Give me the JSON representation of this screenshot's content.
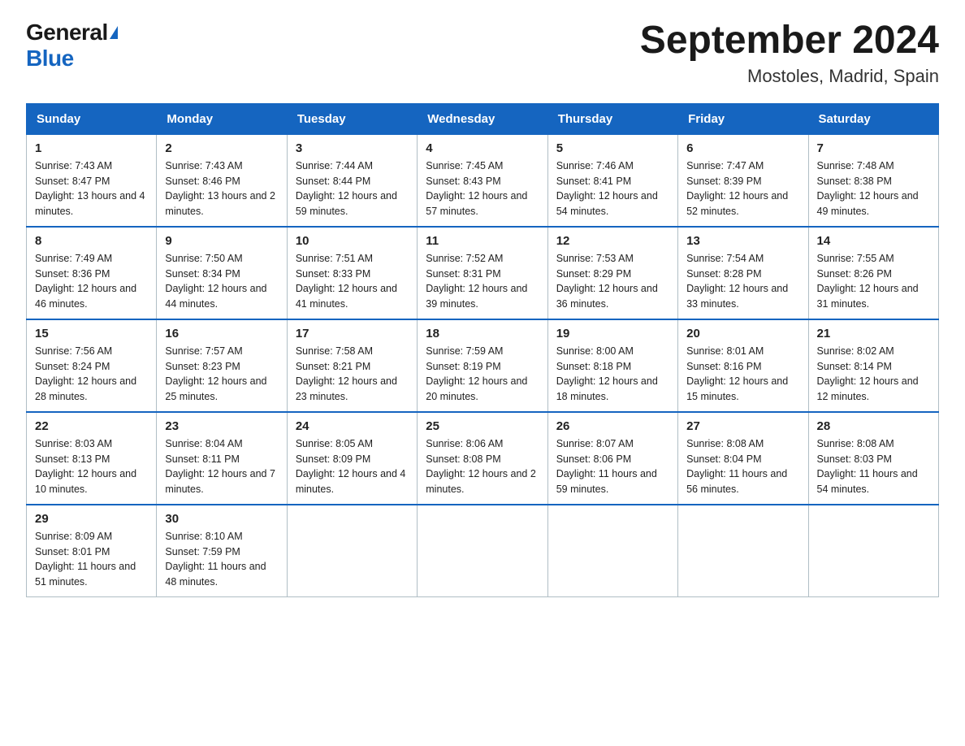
{
  "logo": {
    "text_general": "General",
    "text_blue": "Blue"
  },
  "title": "September 2024",
  "subtitle": "Mostoles, Madrid, Spain",
  "days_of_week": [
    "Sunday",
    "Monday",
    "Tuesday",
    "Wednesday",
    "Thursday",
    "Friday",
    "Saturday"
  ],
  "weeks": [
    [
      {
        "day": "1",
        "sunrise": "7:43 AM",
        "sunset": "8:47 PM",
        "daylight": "13 hours and 4 minutes."
      },
      {
        "day": "2",
        "sunrise": "7:43 AM",
        "sunset": "8:46 PM",
        "daylight": "13 hours and 2 minutes."
      },
      {
        "day": "3",
        "sunrise": "7:44 AM",
        "sunset": "8:44 PM",
        "daylight": "12 hours and 59 minutes."
      },
      {
        "day": "4",
        "sunrise": "7:45 AM",
        "sunset": "8:43 PM",
        "daylight": "12 hours and 57 minutes."
      },
      {
        "day": "5",
        "sunrise": "7:46 AM",
        "sunset": "8:41 PM",
        "daylight": "12 hours and 54 minutes."
      },
      {
        "day": "6",
        "sunrise": "7:47 AM",
        "sunset": "8:39 PM",
        "daylight": "12 hours and 52 minutes."
      },
      {
        "day": "7",
        "sunrise": "7:48 AM",
        "sunset": "8:38 PM",
        "daylight": "12 hours and 49 minutes."
      }
    ],
    [
      {
        "day": "8",
        "sunrise": "7:49 AM",
        "sunset": "8:36 PM",
        "daylight": "12 hours and 46 minutes."
      },
      {
        "day": "9",
        "sunrise": "7:50 AM",
        "sunset": "8:34 PM",
        "daylight": "12 hours and 44 minutes."
      },
      {
        "day": "10",
        "sunrise": "7:51 AM",
        "sunset": "8:33 PM",
        "daylight": "12 hours and 41 minutes."
      },
      {
        "day": "11",
        "sunrise": "7:52 AM",
        "sunset": "8:31 PM",
        "daylight": "12 hours and 39 minutes."
      },
      {
        "day": "12",
        "sunrise": "7:53 AM",
        "sunset": "8:29 PM",
        "daylight": "12 hours and 36 minutes."
      },
      {
        "day": "13",
        "sunrise": "7:54 AM",
        "sunset": "8:28 PM",
        "daylight": "12 hours and 33 minutes."
      },
      {
        "day": "14",
        "sunrise": "7:55 AM",
        "sunset": "8:26 PM",
        "daylight": "12 hours and 31 minutes."
      }
    ],
    [
      {
        "day": "15",
        "sunrise": "7:56 AM",
        "sunset": "8:24 PM",
        "daylight": "12 hours and 28 minutes."
      },
      {
        "day": "16",
        "sunrise": "7:57 AM",
        "sunset": "8:23 PM",
        "daylight": "12 hours and 25 minutes."
      },
      {
        "day": "17",
        "sunrise": "7:58 AM",
        "sunset": "8:21 PM",
        "daylight": "12 hours and 23 minutes."
      },
      {
        "day": "18",
        "sunrise": "7:59 AM",
        "sunset": "8:19 PM",
        "daylight": "12 hours and 20 minutes."
      },
      {
        "day": "19",
        "sunrise": "8:00 AM",
        "sunset": "8:18 PM",
        "daylight": "12 hours and 18 minutes."
      },
      {
        "day": "20",
        "sunrise": "8:01 AM",
        "sunset": "8:16 PM",
        "daylight": "12 hours and 15 minutes."
      },
      {
        "day": "21",
        "sunrise": "8:02 AM",
        "sunset": "8:14 PM",
        "daylight": "12 hours and 12 minutes."
      }
    ],
    [
      {
        "day": "22",
        "sunrise": "8:03 AM",
        "sunset": "8:13 PM",
        "daylight": "12 hours and 10 minutes."
      },
      {
        "day": "23",
        "sunrise": "8:04 AM",
        "sunset": "8:11 PM",
        "daylight": "12 hours and 7 minutes."
      },
      {
        "day": "24",
        "sunrise": "8:05 AM",
        "sunset": "8:09 PM",
        "daylight": "12 hours and 4 minutes."
      },
      {
        "day": "25",
        "sunrise": "8:06 AM",
        "sunset": "8:08 PM",
        "daylight": "12 hours and 2 minutes."
      },
      {
        "day": "26",
        "sunrise": "8:07 AM",
        "sunset": "8:06 PM",
        "daylight": "11 hours and 59 minutes."
      },
      {
        "day": "27",
        "sunrise": "8:08 AM",
        "sunset": "8:04 PM",
        "daylight": "11 hours and 56 minutes."
      },
      {
        "day": "28",
        "sunrise": "8:08 AM",
        "sunset": "8:03 PM",
        "daylight": "11 hours and 54 minutes."
      }
    ],
    [
      {
        "day": "29",
        "sunrise": "8:09 AM",
        "sunset": "8:01 PM",
        "daylight": "11 hours and 51 minutes."
      },
      {
        "day": "30",
        "sunrise": "8:10 AM",
        "sunset": "7:59 PM",
        "daylight": "11 hours and 48 minutes."
      },
      null,
      null,
      null,
      null,
      null
    ]
  ],
  "labels": {
    "sunrise": "Sunrise:",
    "sunset": "Sunset:",
    "daylight": "Daylight:"
  }
}
